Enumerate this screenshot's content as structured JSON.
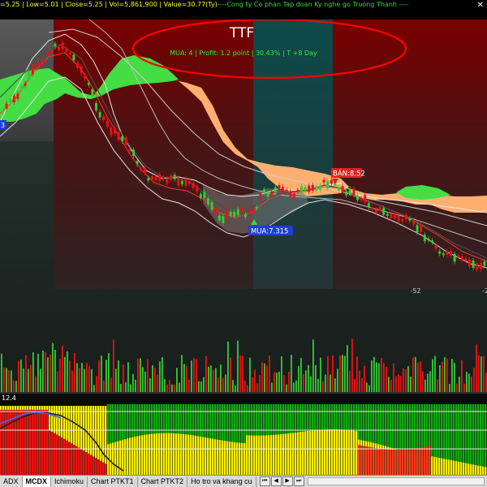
{
  "info_bar": {
    "prefix": "=5.25 | Low=5.01 | Close=5.25 | Vol=5,861,900 | Value=30.77(Ty)",
    "company": "----Cong ty Co phan Tap doan Ky nghe go Truong Thanh ----"
  },
  "annotation": {
    "ticker": "TTF",
    "summary": "MUA:  4  | Profit: 1.2 point | 30.43%  |  T +8 Day"
  },
  "signals": {
    "buy_label": "MUA:7.315",
    "sell_label": "BÁN:8.52"
  },
  "axis": {
    "tick_labels": [
      "-52",
      "-2"
    ]
  },
  "left_cut_label": "3",
  "oscillator_label": "12.4",
  "tabs": [
    {
      "label": "ADX",
      "active": false
    },
    {
      "label": "MCDX",
      "active": true
    },
    {
      "label": "Ichimoku",
      "active": false
    },
    {
      "label": "Chart PTKT1",
      "active": false
    },
    {
      "label": "Chart PTKT2",
      "active": false
    },
    {
      "label": "Ho tro va khang cu",
      "active": false
    }
  ],
  "tab_nav": [
    "⏮",
    "◀",
    "▶",
    "⏭"
  ],
  "colors": {
    "bull_candle": "#33cc33",
    "bear_candle": "#ee1111",
    "cloud_bull": "#44dd44",
    "cloud_bear": "#ffb070",
    "buy_marker": "#2244dd",
    "sell_marker": "#dd2222",
    "annotation_ellipse": "#ff0000"
  }
}
